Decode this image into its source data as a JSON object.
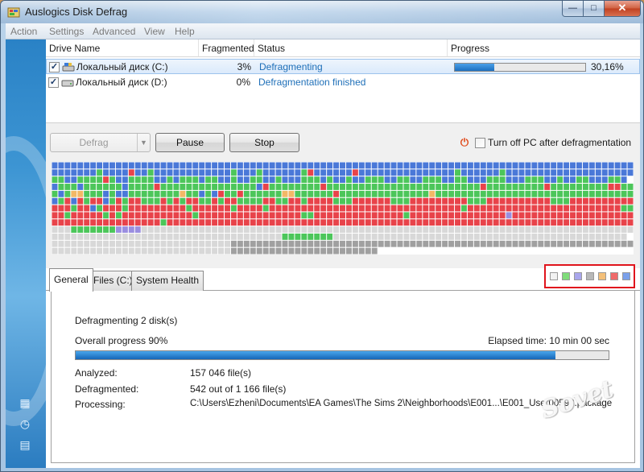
{
  "window": {
    "title": "Auslogics Disk Defrag"
  },
  "menu": [
    "Action",
    "Settings",
    "Advanced",
    "View",
    "Help"
  ],
  "drive_table": {
    "columns": [
      "Drive Name",
      "Fragmented",
      "Status",
      "Progress"
    ],
    "rows": [
      {
        "name": "Локальный диск (C:)",
        "fragmented": "3%",
        "status": "Defragmenting",
        "progress_text": "30,16%",
        "progress": 0.3016,
        "checked": true
      },
      {
        "name": "Локальный диск (D:)",
        "fragmented": "0%",
        "status": "Defragmentation finished",
        "progress_text": "",
        "progress": 0,
        "checked": true
      }
    ]
  },
  "toolbar": {
    "defrag_label": "Defrag",
    "pause_label": "Pause",
    "stop_label": "Stop",
    "turnoff_label": "Turn off PC after defragmentation"
  },
  "disk_map": {
    "colors": {
      "B": "#4a78d8",
      "G": "#4cc65a",
      "R": "#e8434a",
      "P": "#9a8ee0",
      "O": "#f2b866",
      "D": "#a0a0a0",
      "L": "#d8d8d8",
      "W": "#ffffff"
    },
    "rows": [
      "BBBBBBBBBBBBBBBBBBBBBBBBBBBBBBBBBBBBBBBBBBBBBBBBBBBBBBBBBBBBBBBBBBBBBBBBBBBBBBBBBBBBBBBBBBB",
      "BBBBBBBGBBBBRBBGBBBBBBBBBBBBGBBBGBBBBBBGRBBBBBBRBBBBBBBBBBBBBBBGBBBBBBGBBBBBBBBBBBBBBBBBBBB",
      "GGBBGGGGRGBBGGGGBBGBGGGBGGBBGBBGGBBGBBBGGGBGBBGBBGGGBBGGBBGGGBBGGBBBGGGBBBGGGBBGBBGGBBBGGB",
      "BGGGBGGGGGGBGGGGRGGGGGGGGGGGGGGGBRGGGGGGGGRGGGGGGGGGGGGGGGGGGGGGGGGRGGGGGGGGGRGGGGGGGGGRRGGB",
      "GBGOOGGGBGBBGGGGGGGGOGGBGBRGGRGGGGGGOOGGGGGGRGGGGGGGGGGGGGGOGGGGGGGGGGGGGGGGGGGGGGGGGGGGGGG",
      "BGRBRGRRBGRGRRGGGRGRGRRGGRGRRGGGGRRGGRRGRRRRGGGRRRRRRGGGRRRRRRRRRGGGRRRRRRRRRRGGGRRRRRRRRRR",
      "RRRGRRBGRRRGRRRRRRRRRGRRRRRRGRRRRGRRRRRRRRRRRRRRRRRRRRRRRRRRRRRRGRRRRRRRRRRRRRRRRRRRRRRRRGG",
      "RRGRRRRRGRGRRRRRRRRRRRGRRRRRRRRRRRRRRRRGGRRRRRRRRRRRRRRGRRRRRRRRRRRRRRRPRRRRRRRRRRRRRRRRRRR",
      "RRRRRRRRRRRRRRRRRGRRRRRRRRRRRRRRRRRRRRRRRRRRRRRRRRRRRRRRRRRRRRRRRRRRRRRRRRRRRRRRRRRRRRRRRRRR",
      "LLLGGGGGGGPPPPLLLLLLLLLLLLLLLLLLLLLLLLLLLLLLLLLLLLLLLLLLLLLLLLLLLLLLLLLLLLLLLLLLLLLLLLLLLLL",
      "LLLLLLLLLLLLLLLLLLLLLLLLLLLLLLLLLLLLGGGGGGGGLLLLLLLLLLLLLLLLLLLLLLLLLLLLLLLLLLLLLLLLLLLLLL",
      "LLLLLLLLLLLLLLLLLLLLLLLLLLLLDDDDDDDDDDDDDDDDDDDDDDDDDDDDDDDDDDDDDDDDDDDDDDDDDDDDDDDDDDDDDDDD",
      "LLLLLLLLLLLLLLLLLLLLLLLLLLLLDDDDDDDDDDDDDDDDDDDDDDDWWWWWWWWWWWWWWWWWWWWWWWWWWWWWWWWWWWWWWWW"
    ]
  },
  "tabs": [
    "General",
    "Files (C:)",
    "System Health"
  ],
  "legend_colors": [
    "#f2f2f2",
    "#7fdc7a",
    "#a9a6ec",
    "#b8b8b8",
    "#f4c07a",
    "#ef6a6a",
    "#7aa0ea"
  ],
  "general": {
    "heading": "Defragmenting 2 disk(s)",
    "overall_label": "Overall progress 90%",
    "overall_progress": 0.9,
    "elapsed": "Elapsed time: 10 min 00 sec",
    "analyzed_label": "Analyzed:",
    "analyzed_value": "157 046 file(s)",
    "defragmented_label": "Defragmented:",
    "defragmented_value": "542 out of 1 166 file(s)",
    "processing_label": "Processing:",
    "processing_value": "C:\\Users\\Ezheni\\Documents\\EA Games\\The Sims 2\\Neighborhoods\\E001...\\E001_User00593.package"
  },
  "watermark": "Sovet",
  "sidebar_icons": [
    "map-icon",
    "clock-icon",
    "report-icon"
  ]
}
